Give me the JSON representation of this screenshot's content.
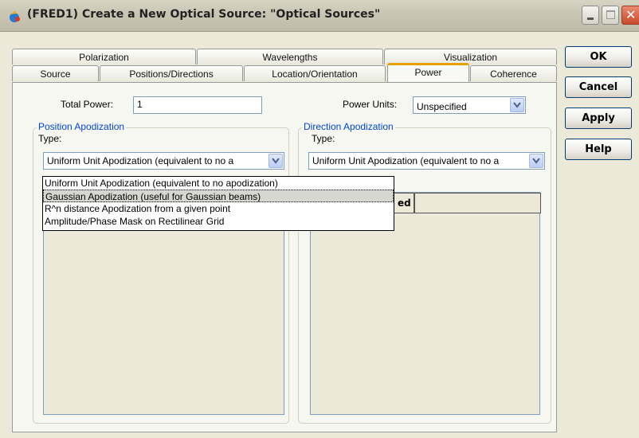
{
  "window": {
    "title": "(FRED1) Create a New Optical Source: \"Optical Sources\"",
    "icon": "optical-source-app-icon"
  },
  "buttons": {
    "ok": "OK",
    "cancel": "Cancel",
    "apply": "Apply",
    "help": "Help"
  },
  "tabs_row1": [
    "Polarization",
    "Wavelengths",
    "Visualization"
  ],
  "tabs_row2": [
    "Source",
    "Positions/Directions",
    "Location/Orientation",
    "Power",
    "Coherence"
  ],
  "active_tab": "Power",
  "power": {
    "total_power_label": "Total Power:",
    "total_power_value": "1",
    "units_label": "Power Units:",
    "units_value": "Unspecified"
  },
  "position_apodization": {
    "title": "Position Apodization",
    "type_label": "Type:",
    "type_value": "Uniform Unit Apodization (equivalent to no a",
    "options": [
      "Uniform Unit Apodization (equivalent to no apodization)",
      "Gaussian Apodization (useful for Gaussian beams)",
      "R^n distance Apodization from a given point",
      "Amplitude/Phase Mask on Rectilinear Grid"
    ],
    "highlighted_index": 1
  },
  "direction_apodization": {
    "title": "Direction Apodization",
    "type_label": "Type:",
    "type_value": "Uniform Unit Apodization (equivalent to no a",
    "column_header_partial": "ed"
  },
  "colors": {
    "accent_tab": "#e8a100",
    "group_title": "#0046d5",
    "dialog_bg": "#ece9d8"
  }
}
